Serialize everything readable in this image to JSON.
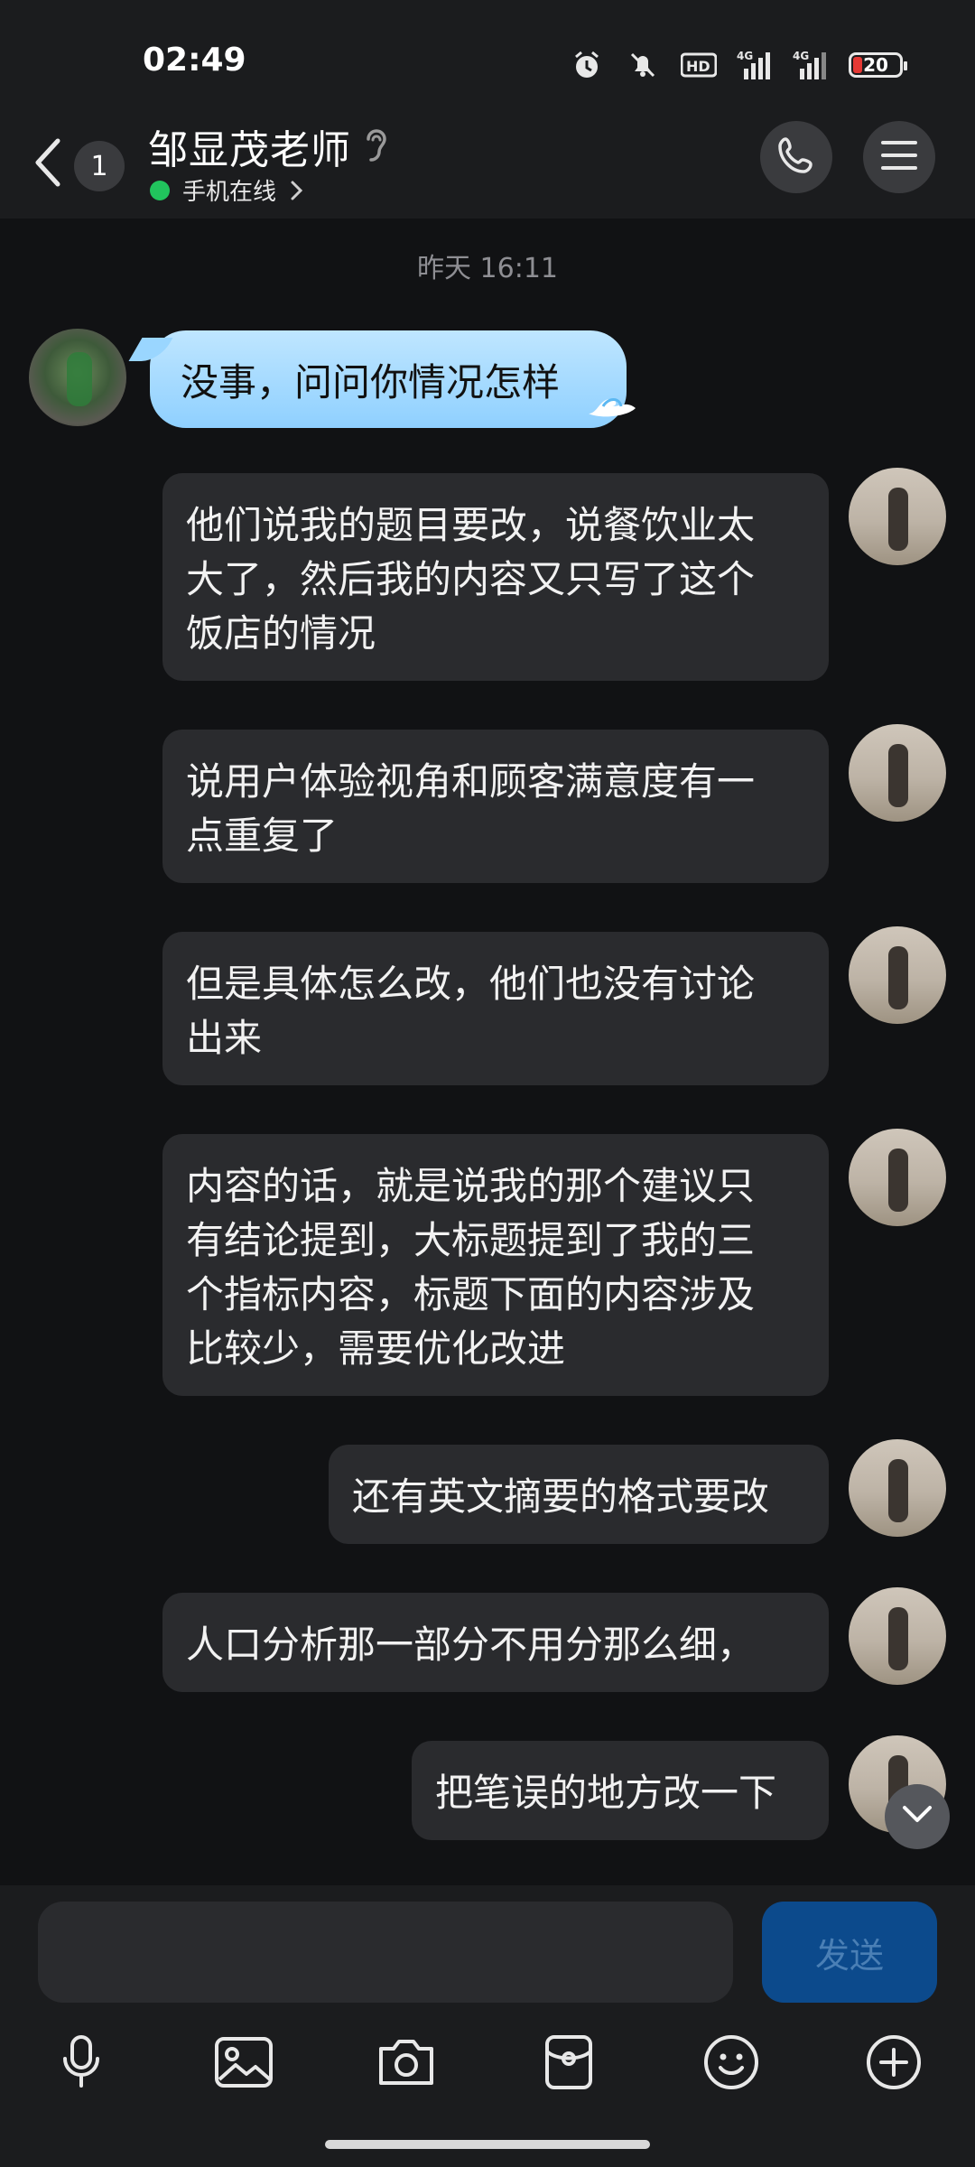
{
  "status_bar": {
    "time": "02:49",
    "battery": "20"
  },
  "header": {
    "unread_count": "1",
    "contact_name": "邹显茂老师",
    "status_text": "手机在线"
  },
  "conversation": {
    "timestamp": "昨天 16:11",
    "messages": [
      {
        "side": "left",
        "text": "没事，问问你情况怎样"
      },
      {
        "side": "right",
        "text": "他们说我的题目要改，说餐饮业太\n大了，然后我的内容又只写了这个\n饭店的情况"
      },
      {
        "side": "right",
        "text": "说用户体验视角和顾客满意度有一\n点重复了"
      },
      {
        "side": "right",
        "text": "但是具体怎么改，他们也没有讨论\n出来"
      },
      {
        "side": "right",
        "text": "内容的话，就是说我的那个建议只\n有结论提到，大标题提到了我的三\n个指标内容，标题下面的内容涉及\n比较少，需要优化改进"
      },
      {
        "side": "right",
        "text": "还有英文摘要的格式要改"
      },
      {
        "side": "right",
        "text": "人口分析那一部分不用分那么细，"
      },
      {
        "side": "right",
        "text": "把笔误的地方改一下"
      }
    ]
  },
  "composer": {
    "placeholder": "",
    "send_label": "发送"
  },
  "toolbar": {
    "icons": [
      "microphone-icon",
      "image-icon",
      "camera-icon",
      "red-packet-icon",
      "emoji-icon",
      "plus-icon"
    ]
  },
  "colors": {
    "background": "#111214",
    "bubble": "#2a2b2e",
    "online": "#21c45d",
    "send_button": "#0c4a8c"
  }
}
